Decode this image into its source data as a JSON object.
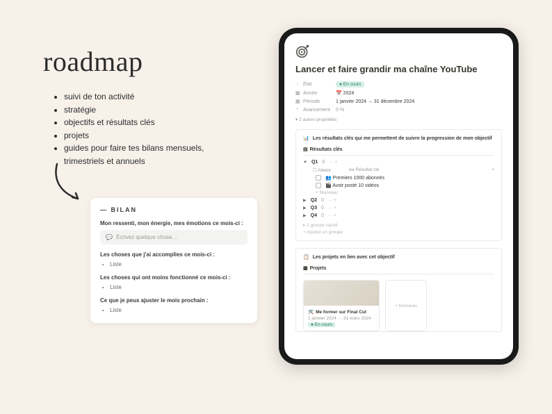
{
  "heading": "roadmap",
  "bullets": [
    "suivi de ton activité",
    "stratégie",
    "objectifs et résultats clés",
    "projets",
    "guides pour faire tes bilans mensuels, trimestriels et annuels"
  ],
  "bilan": {
    "title": "— BILAN",
    "q1": "Mon ressenti, mon énergie, mes émotions ce mois-ci :",
    "placeholder": "Écrivez quelque chose…",
    "q2": "Les choses que j'ai accomplies ce mois-ci :",
    "q3": "Les choses qui ont moins fonctionné ce mois-ci :",
    "q4": "Ce que je peux ajuster le mois prochain :",
    "list_item": "Liste"
  },
  "notion": {
    "title": "Lancer et faire grandir ma chaîne YouTube",
    "props": {
      "etat_label": "État",
      "etat_value": "En cours",
      "annee_label": "Année",
      "annee_value": "2024",
      "periode_label": "Période",
      "periode_value": "1 janvier 2024 → 31 décembre 2024",
      "avancement_label": "Avancement",
      "avancement_value": "0 %"
    },
    "more_props": "2 autres propriétés",
    "kr_block": {
      "heading": "Les résultats clés qui me permettent de suivre la progression de mon objectif",
      "view_tab": "Résultats clés",
      "col_atteint": "Atteint",
      "col_resultat": "Aa Résultat clé",
      "quarters": {
        "q1": "Q1",
        "q2": "Q2",
        "q3": "Q3",
        "q4": "Q4",
        "count": "0"
      },
      "kr1": "Premiers 1000 abonnés",
      "kr2": "Avoir posté 10 vidéos",
      "new_row": "+ Nouveau",
      "hidden_group": "1 groupe caché",
      "add_group": "+ Ajouter un groupe"
    },
    "proj_block": {
      "heading": "Les projets en lien avec cet objectif",
      "view_tab": "Projets",
      "card": {
        "title": "Me former sur Final Cut",
        "date": "1 janvier 2024 → 31 mars 2024",
        "status": "En cours"
      },
      "new_card": "+ Nouveau"
    }
  }
}
